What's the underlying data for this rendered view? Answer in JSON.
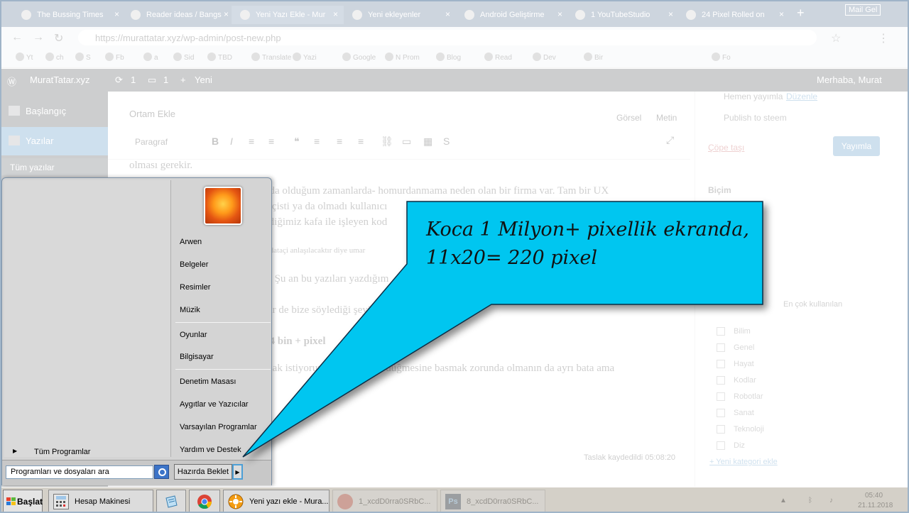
{
  "browser": {
    "tabs": [
      {
        "label": "The Bussing Times"
      },
      {
        "label": "Reader ideas / Bangs"
      },
      {
        "label": "Yeni Yazı Ekle - Mur"
      },
      {
        "label": "Yeni ekleyenler"
      },
      {
        "label": "Android Geliştirme"
      },
      {
        "label": "1 YouTubeStudio"
      },
      {
        "label": "24 Pixel Rolled on"
      }
    ],
    "new_tab": "+",
    "window_user": "Mail Gel",
    "url": "https://murattatar.xyz/wp-admin/post-new.php",
    "bookmarks": [
      "Yt",
      "ch",
      "S",
      "Fb",
      "a",
      "Sid",
      "TBD",
      "Translate",
      "Yazi",
      "Google",
      "N Prom",
      "Blog",
      "Read",
      "Dev",
      "Bir",
      "Fo"
    ]
  },
  "wordpress": {
    "site_name": "MuratTatar.xyz",
    "updates": "1",
    "comments": "1",
    "new_label": "Yeni",
    "greeting": "Merhaba, Murat",
    "menu": [
      "Başlangıç",
      "Yazılar"
    ],
    "submenu_item": "Tüm yazılar",
    "editor": {
      "tabs": [
        "Görsel",
        "Metin"
      ],
      "add_media": "Ortam Ekle",
      "format": "Paragraf",
      "paragraphs": [
        "olması gerekir.",
        "nda olduğum zamanlarda- homurdanmama neden olan bir firma var. Tam bir UX",
        "atçisti ya da olmadı kullanıcı",
        "ediğimiz kafa ile işleyen kod",
        "e dataçi anlaşılacaktır diye umar",
        "a; Şu an bu yazıları yazdığım",
        "bir de bize söylediği şeyi katılım. Çarpanı :)",
        "44 bin + pixel",
        "mak istiyorum. Önce Başlat düğmesine basmak zorunda olmanın da ayrı bata ama"
      ],
      "autosave": "Taslak kaydedildi 05:08:20"
    },
    "publish": {
      "publish_now": "Hemen yayımla",
      "edit": "Düzenle",
      "publish_to_x": "Publish to steem",
      "move_trash": "Çöpe taşı",
      "publish_button": "Yayımla",
      "format_title": "Biçim",
      "category_tab": "En çok kullanılan",
      "categories": [
        "Bilim",
        "Genel",
        "Hayat",
        "Kodlar",
        "Robotlar",
        "Sanat",
        "Teknoloji",
        "Diz"
      ],
      "add_category": "+ Yeni kategori ekle"
    }
  },
  "start_menu": {
    "user_tile": "user-picture-flower",
    "items": [
      "Arwen",
      "Belgeler",
      "Resimler",
      "Müzik",
      "Oyunlar",
      "Bilgisayar",
      "Denetim Masası",
      "Aygıtlar ve Yazıcılar",
      "Varsayılan Programlar",
      "Yardım ve Destek"
    ],
    "all_programs": "Tüm Programlar",
    "search_placeholder": "Programları ve dosyaları ara",
    "sleep_button": "Hazırda Beklet"
  },
  "taskbar": {
    "start": "Başlat",
    "apps": [
      {
        "label": "Hesap Makinesi",
        "icon": "calculator-icon"
      },
      {
        "label": "",
        "icon": "notepad-icon"
      },
      {
        "label": "",
        "icon": "chrome-icon"
      },
      {
        "label": "Yeni yazı ekle - Mura...",
        "icon": "chrome-app-icon"
      },
      {
        "label": "1_xcdD0rra0SRbC...",
        "icon": "paint-icon"
      },
      {
        "label": "8_xcdD0rra0SRbC...",
        "icon": "photoshop-icon"
      }
    ],
    "clock_time": "05:40",
    "clock_date": "21.11.2018"
  },
  "callout": {
    "line1": "Koca 1 Milyon+ pixellik ekranda,",
    "line2": "11x20= 220 pixel",
    "fill": "#00c6f0",
    "stroke": "#0b2d44"
  }
}
